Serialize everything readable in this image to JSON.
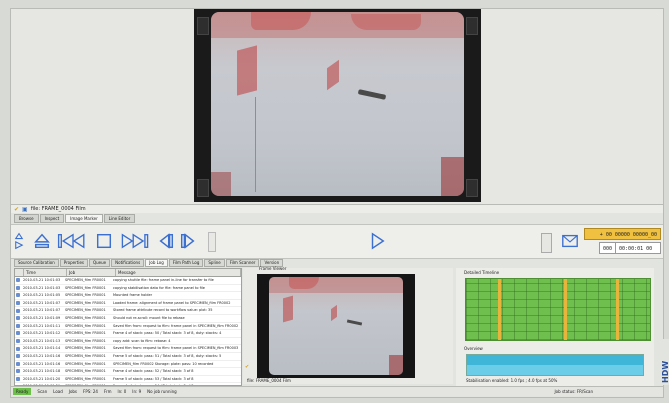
{
  "window": {
    "title": "file: FRAME_0004 Film"
  },
  "main_tabs": [
    "Browse",
    "Inspect",
    "Image Marker",
    "Line Editor"
  ],
  "active_main_tab": 2,
  "sub_tabs": [
    "Source Calibration",
    "Properties",
    "Queue",
    "Notifications",
    "Job Log",
    "Film Path Log",
    "Spline",
    "Film Scanner",
    "Version"
  ],
  "active_sub_tab": 4,
  "counter": {
    "top": "+ 00 00000 00000_00",
    "bottom_a": "000",
    "bottom_b": "00:00:01 00"
  },
  "log": {
    "columns": [
      "Time",
      "Job",
      "Message"
    ],
    "rows": [
      [
        "2010-03-21 10:01:03",
        "SPECIMEN_film FR0001",
        "copying shuttle file: frame panel in-line for transfer to file"
      ],
      [
        "2010-03-21 10:01:03",
        "SPECIMEN_film FR0001",
        "copying stabilisation data for file: frame panel to file"
      ],
      [
        "2010-03-21 10:01:05",
        "SPECIMEN_film FR0001",
        "Mounted frame holder"
      ],
      [
        "2010-03-21 10:01:07",
        "SPECIMEN_film FR0001",
        "Loaded frame: alignment of frame panel to SPECIMEN_film FR0002"
      ],
      [
        "2010-03-21 10:01:07",
        "SPECIMEN_film FR0001",
        "Stored frame attribute record to workflow value: plot: 35"
      ],
      [
        "2010-03-21 10:01:09",
        "SPECIMEN_film FR0001",
        "Should not re-scroll: mount file to rebase"
      ],
      [
        "2010-03-21 10:01:11",
        "SPECIMEN_film FR0001",
        "Saved film from: request to film: frame panel in SPECIMEN_film FR0002"
      ],
      [
        "2010-03-21 10:01:12",
        "SPECIMEN_film FR0001",
        "Frame 4 of stack: pass: 50 / Total stack: 3 of 8, duty: stacks: 4"
      ],
      [
        "2010-03-21 10:01:13",
        "SPECIMEN_film FR0001",
        "copy add: scan to film: rebase: 4"
      ],
      [
        "2010-03-21 10:01:14",
        "SPECIMEN_film FR0001",
        "Saved film from: request to film: frame panel in SPECIMEN_film FR0003"
      ],
      [
        "2010-03-21 10:01:16",
        "SPECIMEN_film FR0001",
        "Frame 5 of stack: pass: 51 / Total stack: 3 of 8, duty: stacks: 5"
      ],
      [
        "2010-03-21 10:01:16",
        "SPECIMEN_film FR0001",
        "SPECIMEN_film FR0002 Storage: plate: pass: 10 recorded"
      ],
      [
        "2010-03-21 10:01:18",
        "SPECIMEN_film FR0001",
        "Frame 4 of stack: pass: 52 / Total stack: 3 of 8"
      ],
      [
        "2010-03-21 10:01:20",
        "SPECIMEN_film FR0001",
        "Frame 5 of stack: pass: 53 / Total stack: 3 of 8"
      ],
      [
        "2010-03-21 10:01:21",
        "SPECIMEN_film FR0001",
        "Frame 4 of stack: pass: 54 / Total stack: 3 of 8"
      ],
      [
        "2010-03-21 10:01:22",
        "SPECIMEN_film FR0001",
        "Film: Scan Done: Scan finishing"
      ]
    ]
  },
  "preview": {
    "title": "Frame Viewer",
    "caption": "file: FRAME_0004 Film"
  },
  "right_panel": {
    "grid_title": "Detailed Timeline",
    "overview_title": "Overview",
    "status": "Stabilisation enabled: 1.0 fps ; 4.0 fps at 50%"
  },
  "statusbar": {
    "items": [
      "Ready",
      "Scan",
      "Load",
      "Jobs",
      "FPS: 24",
      "Frm",
      "ln: 0",
      "In: 9",
      "No job running",
      "Job status: FR/Scan"
    ]
  },
  "icons": {
    "eject": "eject-icon",
    "prev": "skip-back-icon",
    "stop": "stop-icon",
    "next": "skip-forward-icon",
    "step_back": "step-back-icon",
    "step_fwd": "step-forward-icon",
    "play": "play-icon",
    "mail": "mail-icon"
  }
}
